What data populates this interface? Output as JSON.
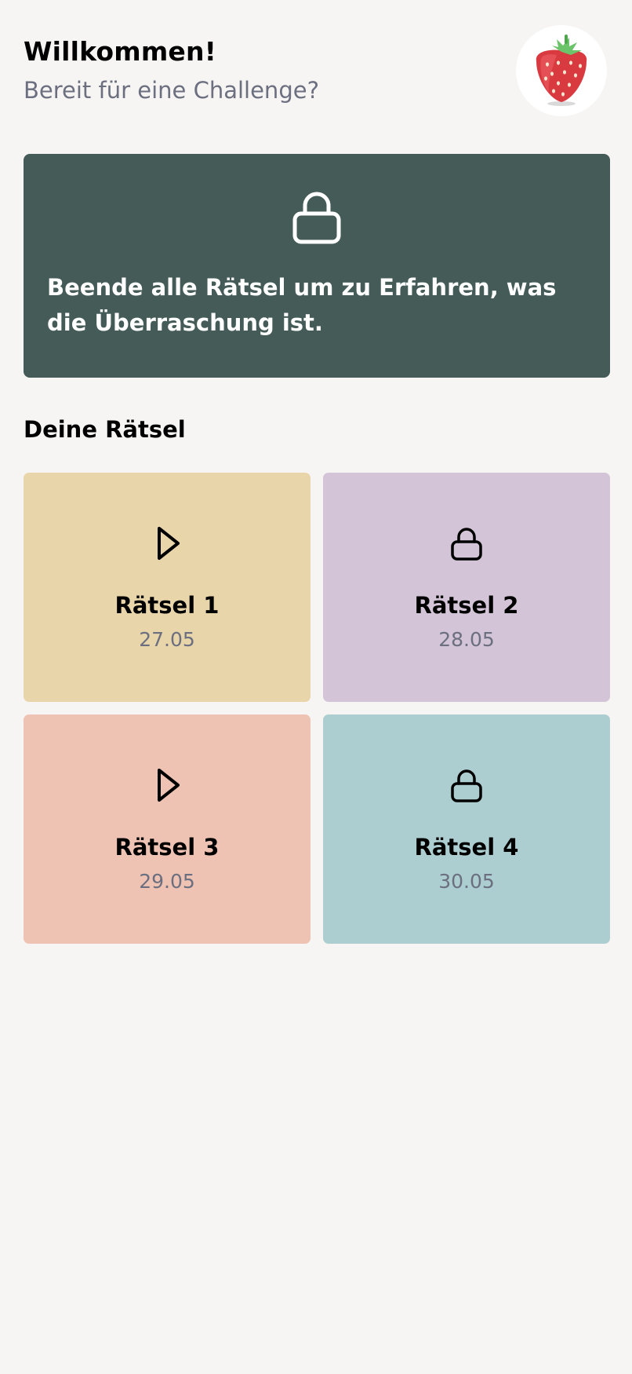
{
  "header": {
    "title": "Willkommen!",
    "subtitle": "Bereit für eine Challenge?",
    "avatar_icon": "strawberry-icon"
  },
  "banner": {
    "icon": "lock-icon",
    "text": "Beende alle Rätsel um zu Erfahren, was die Überraschung ist.",
    "background": "#445b58"
  },
  "section": {
    "title": "Deine Rätsel"
  },
  "puzzles": [
    {
      "name": "Rätsel 1",
      "date": "27.05",
      "icon": "play-icon",
      "color": "#e9d5aa"
    },
    {
      "name": "Rätsel 2",
      "date": "28.05",
      "icon": "lock-icon",
      "color": "#d3c5d7"
    },
    {
      "name": "Rätsel 3",
      "date": "29.05",
      "icon": "play-icon",
      "color": "#eec3b3"
    },
    {
      "name": "Rätsel 4",
      "date": "30.05",
      "icon": "lock-icon",
      "color": "#adced1"
    }
  ]
}
